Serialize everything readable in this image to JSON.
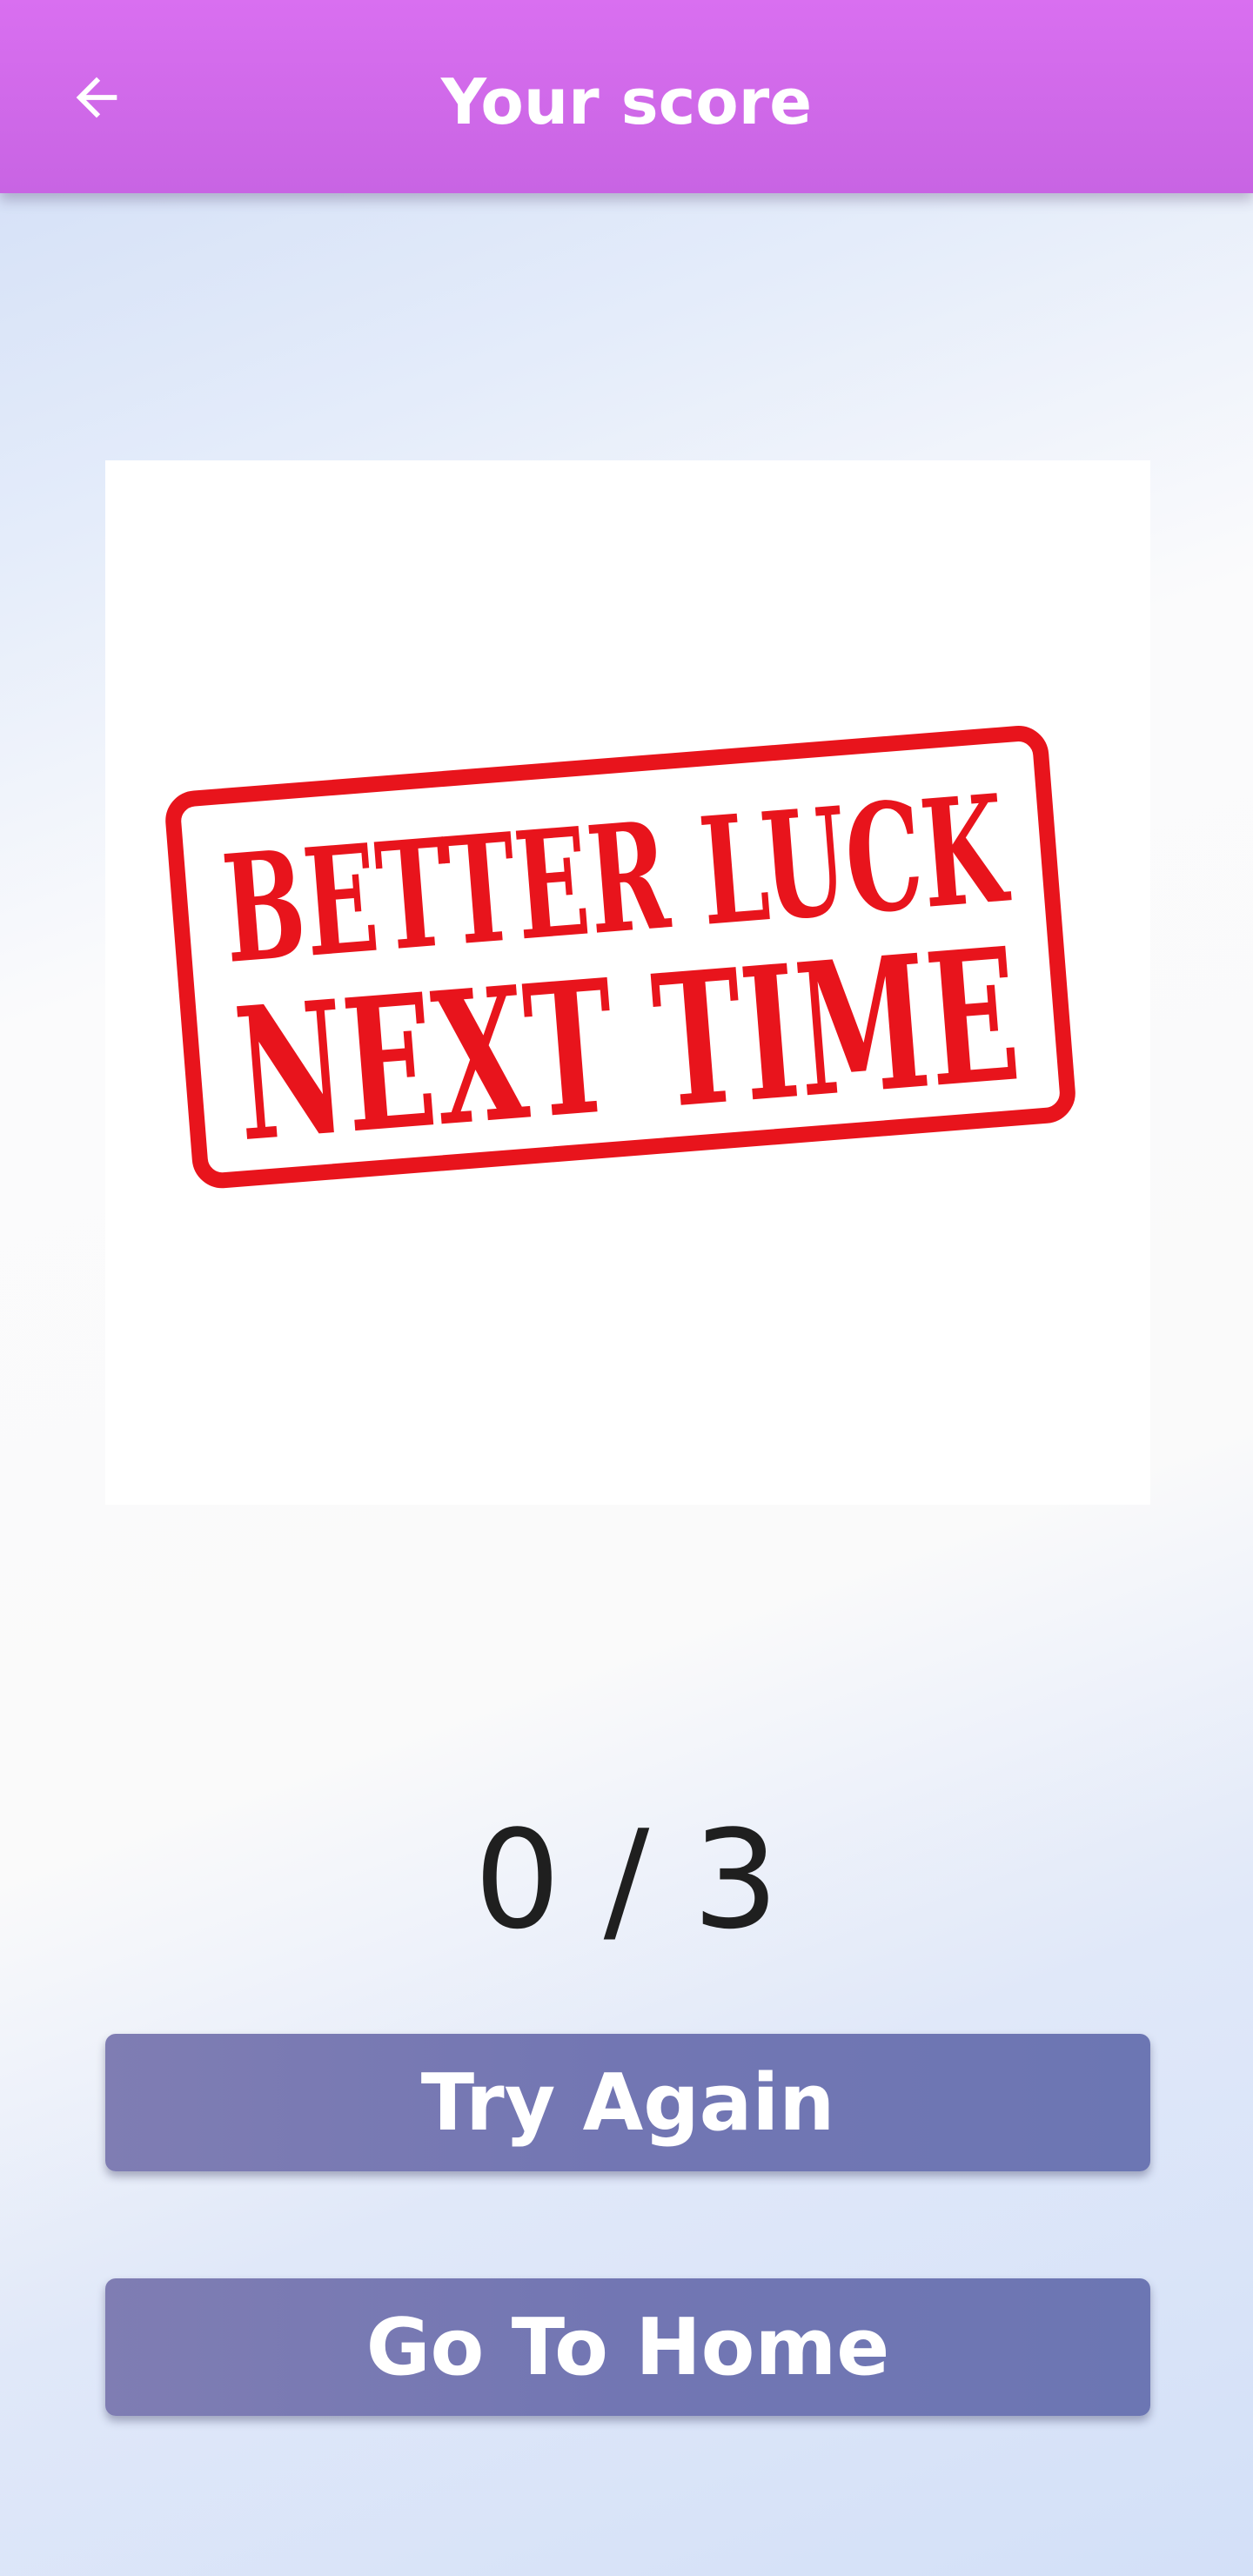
{
  "app_bar": {
    "title": "Your score",
    "back_icon": "arrow-left-icon",
    "color": "#c864e3"
  },
  "result_image": {
    "stamp_text_line1": "BETTER LUCK",
    "stamp_text_line2": "NEXT TIME",
    "stamp_color": "#e8141c"
  },
  "score": {
    "text": "0 / 3",
    "correct": 0,
    "total": 3
  },
  "buttons": {
    "try_again_label": "Try Again",
    "go_home_label": "Go To Home",
    "color": "#7276b3"
  }
}
